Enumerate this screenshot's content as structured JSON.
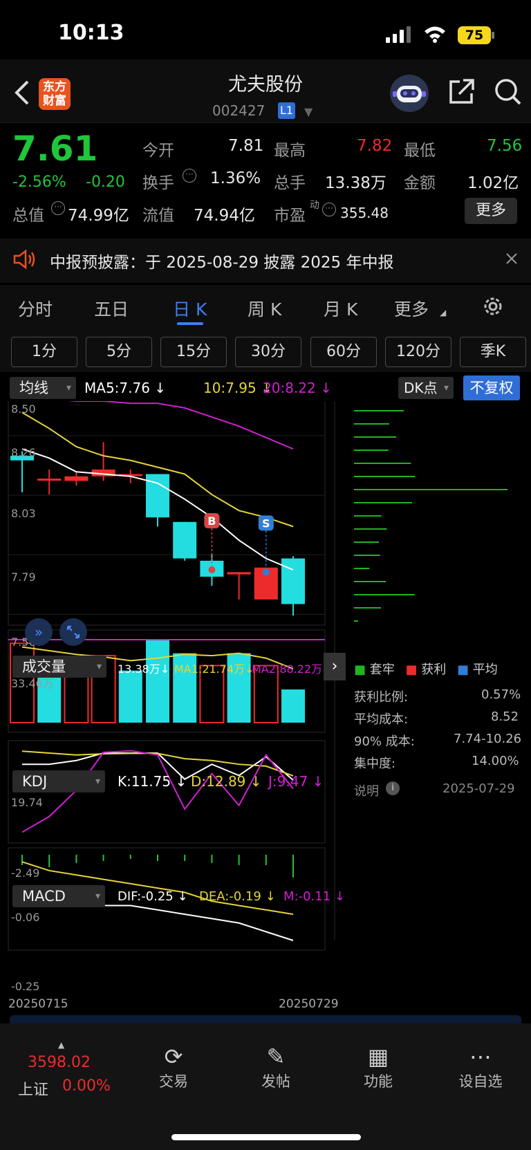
{
  "status": {
    "time": "10:13",
    "battery": "75"
  },
  "header": {
    "logo_line1": "东方",
    "logo_line2": "财富",
    "name": "尤夫股份",
    "code": "002427",
    "level": "L1"
  },
  "quote": {
    "price": "7.61",
    "change_pct": "-2.56%",
    "change": "-0.20",
    "open_label": "今开",
    "open": "7.81",
    "high_label": "最高",
    "high": "7.82",
    "low_label": "最低",
    "low": "7.56",
    "turnover_label": "换手",
    "turnover": "1.36%",
    "vol_label": "总手",
    "vol": "13.38万",
    "amt_label": "金额",
    "amt": "1.02亿",
    "mcap_label": "总值",
    "mcap": "74.99亿",
    "float_label": "流值",
    "float": "74.94亿",
    "pe_label": "市盈",
    "pe_sup": "动",
    "pe": "355.48",
    "more": "更多"
  },
  "notice": {
    "text": "中报预披露：于 2025-08-29 披露 2025 年中报"
  },
  "tabs": [
    "分时",
    "五日",
    "日 K",
    "周 K",
    "月 K",
    "更多"
  ],
  "periods": [
    "1分",
    "5分",
    "15分",
    "30分",
    "60分",
    "120分",
    "季K"
  ],
  "ma_bar": {
    "selector": "均线",
    "ma5": "MA5:7.76",
    "ma10": "10:7.95",
    "ma20": "20:8.22",
    "dk": "DK点",
    "adjust": "不复权"
  },
  "price_axis": [
    "8.50",
    "8.26",
    "8.03",
    "7.79",
    "7.56"
  ],
  "marks": {
    "buy": "B",
    "sell": "S"
  },
  "volume_bar": {
    "selector": "成交量",
    "vol": "13.38万",
    "ma1": "MA1:21.74万",
    "ma2": "MA2:88.22万",
    "axis_top": "33.46万"
  },
  "kdj_bar": {
    "selector": "KDJ",
    "k": "K:11.75",
    "d": "D:12.89",
    "j": "J:9.47",
    "axis_top": "19.74",
    "axis_bottom": "-2.49"
  },
  "macd_bar": {
    "selector": "MACD",
    "dif": "DIF:-0.25",
    "dea": "DEA:-0.19",
    "m": "M:-0.11",
    "axis_top": "-0.06",
    "axis_bottom": "-0.25"
  },
  "dates": {
    "start": "20250715",
    "end": "20250729"
  },
  "chips": {
    "legend": [
      "套牢",
      "获利",
      "平均"
    ],
    "rows": [
      {
        "label": "获利比例:",
        "value": "0.57%"
      },
      {
        "label": "平均成本:",
        "value": "8.52"
      },
      {
        "label": "90% 成本:",
        "value": "7.74-10.26"
      },
      {
        "label": "集中度:",
        "value": "14.00%"
      }
    ],
    "note": "说明",
    "date": "2025-07-29"
  },
  "chart_data": {
    "type": "candlestick",
    "x": [
      "20250715",
      "",
      "",
      "",
      "",
      "",
      "",
      "",
      "",
      "",
      "20250729"
    ],
    "candles": [
      {
        "o": 8.26,
        "c": 8.24,
        "h": 8.28,
        "l": 8.1
      },
      {
        "o": 8.16,
        "c": 8.16,
        "h": 8.2,
        "l": 8.09
      },
      {
        "o": 8.15,
        "c": 8.17,
        "h": 8.19,
        "l": 8.13
      },
      {
        "o": 8.17,
        "c": 8.2,
        "h": 8.32,
        "l": 8.15
      },
      {
        "o": 8.18,
        "c": 8.18,
        "h": 8.2,
        "l": 8.14
      },
      {
        "o": 8.18,
        "c": 7.99,
        "h": 8.18,
        "l": 7.95
      },
      {
        "o": 7.97,
        "c": 7.81,
        "h": 7.97,
        "l": 7.8
      },
      {
        "o": 7.8,
        "c": 7.73,
        "h": 7.83,
        "l": 7.69
      },
      {
        "o": 7.74,
        "c": 7.75,
        "h": 7.75,
        "l": 7.63
      },
      {
        "o": 7.63,
        "c": 7.77,
        "h": 7.77,
        "l": 7.64
      },
      {
        "o": 7.81,
        "c": 7.61,
        "h": 7.82,
        "l": 7.56
      }
    ],
    "ma5": [
      8.29,
      8.25,
      8.19,
      8.18,
      8.17,
      8.14,
      8.07,
      7.99,
      7.89,
      7.81,
      7.76
    ],
    "ma10": [
      8.45,
      8.38,
      8.3,
      8.26,
      8.24,
      8.21,
      8.18,
      8.09,
      8.02,
      7.99,
      7.95
    ],
    "ma20": [
      8.51,
      8.51,
      8.5,
      8.5,
      8.49,
      8.49,
      8.47,
      8.43,
      8.39,
      8.34,
      8.29
    ],
    "ylim": [
      7.56,
      8.5
    ],
    "volume": [
      32.0,
      25.0,
      23.0,
      27.0,
      21.0,
      33.46,
      28.0,
      23.0,
      28.0,
      23.0,
      13.38
    ],
    "volume_up": [
      true,
      false,
      true,
      true,
      false,
      false,
      false,
      true,
      false,
      true,
      false
    ],
    "vol_ma1": [
      30.5,
      29.0,
      27.5,
      26.5,
      25.0,
      26.0,
      27.5,
      27.0,
      28.0,
      26.0,
      21.74
    ],
    "vol_ma2": [
      88.22,
      88.22,
      88.22,
      88.22,
      88.22,
      88.22,
      88.22,
      88.22,
      88.22,
      88.22,
      88.22
    ],
    "vol_ylim": [
      0,
      33.46
    ],
    "kdj_k": [
      16,
      16,
      17,
      19,
      19,
      19,
      12,
      16,
      13,
      18,
      11.75
    ],
    "kdj_d": [
      19.5,
      19,
      18.5,
      18.8,
      18.9,
      18.9,
      17.5,
      17,
      16,
      15.5,
      12.89
    ],
    "kdj_j": [
      -2.2,
      2.0,
      9.0,
      19.2,
      19.6,
      18.5,
      4.0,
      13.5,
      5.0,
      18.5,
      9.47
    ],
    "kdj_ylim": [
      -2.49,
      19.74
    ],
    "macd_dif": [
      -0.15,
      -0.16,
      -0.17,
      -0.17,
      -0.17,
      -0.18,
      -0.19,
      -0.2,
      -0.21,
      -0.23,
      -0.25
    ],
    "macd_dea": [
      -0.07,
      -0.09,
      -0.1,
      -0.11,
      -0.12,
      -0.13,
      -0.14,
      -0.16,
      -0.17,
      -0.18,
      -0.19
    ],
    "macd_m": [
      -0.05,
      -0.06,
      -0.04,
      -0.03,
      -0.02,
      -0.03,
      -0.03,
      -0.04,
      -0.05,
      -0.05,
      -0.11
    ],
    "macd_ylim": [
      -0.25,
      -0.06
    ],
    "chip_bars": [
      12.0,
      8.5,
      10.2,
      8.3,
      13.7,
      14.7,
      37.0,
      14.0,
      6.6,
      7.9,
      6.0,
      6.3,
      3.7,
      7.7,
      14.6,
      6.5,
      1.0
    ],
    "colors": {
      "up": "#ee2b2b",
      "down": "#23dde0",
      "ma5": "#ffffff",
      "ma10": "#e6d439",
      "ma20": "#d21fd2",
      "chip": "#1fb51f",
      "buy": "#d94545",
      "sell": "#2f7fd6"
    }
  }
}
